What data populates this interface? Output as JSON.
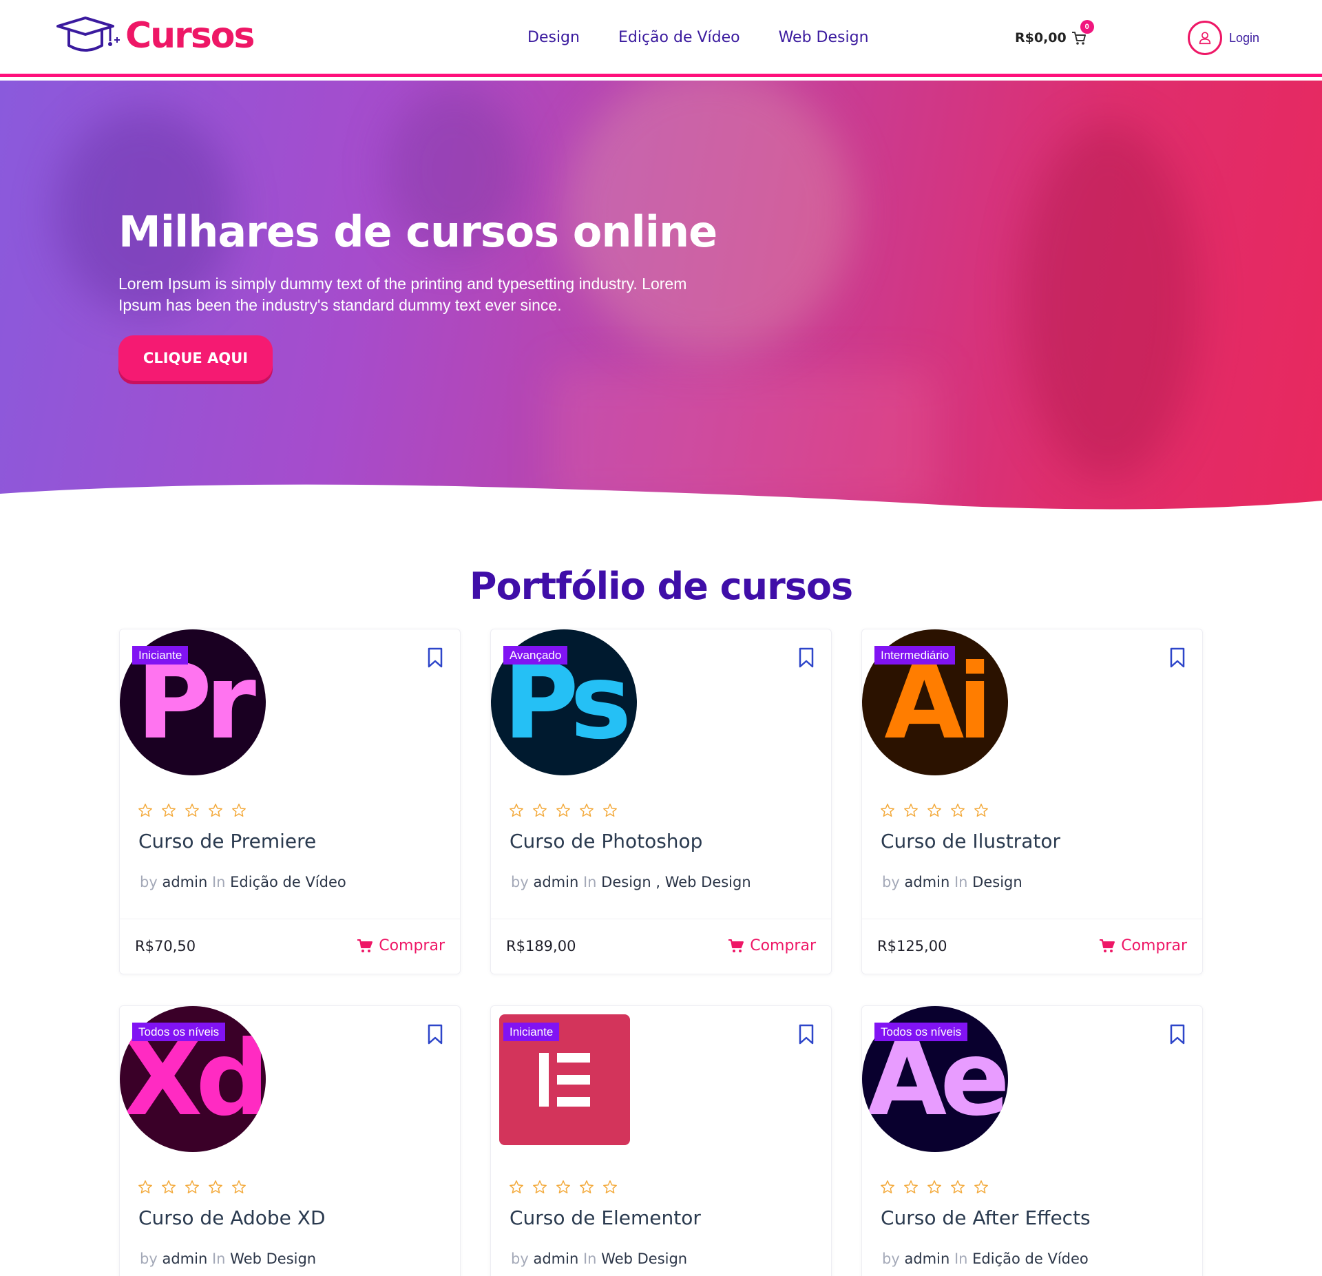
{
  "header": {
    "logo_text": "Cursos",
    "nav": [
      "Design",
      "Edição de Vídeo",
      "Web Design"
    ],
    "cart_total": "R$0,00",
    "cart_count": "0",
    "login_label": "Login"
  },
  "hero": {
    "title": "Milhares de cursos online",
    "description": "Lorem Ipsum is simply dummy text of the printing and typesetting industry. Lorem Ipsum has been the industry's standard dummy text ever since.",
    "button_label": "CLIQUE AQUI"
  },
  "section": {
    "title": "Portfólio de cursos"
  },
  "labels": {
    "by": "by",
    "author": "admin",
    "in": "In",
    "buy": "Comprar"
  },
  "courses": [
    {
      "level": "Iniciante",
      "title": "Curso de Premiere",
      "categories": "Edição de Vídeo",
      "price": "R$70,50",
      "icon": "premiere-pro-icon",
      "icon_text": "Pr",
      "rating": 0
    },
    {
      "level": "Avançado",
      "title": "Curso de Photoshop",
      "categories": "Design ,  Web Design",
      "price": "R$189,00",
      "icon": "photoshop-icon",
      "icon_text": "Ps",
      "rating": 0
    },
    {
      "level": "Intermediário",
      "title": "Curso de Ilustrator",
      "categories": "Design",
      "price": "R$125,00",
      "icon": "illustrator-icon",
      "icon_text": "Ai",
      "rating": 0
    },
    {
      "level": "Todos os níveis",
      "title": "Curso de Adobe XD",
      "categories": "Web Design",
      "icon": "adobe-xd-icon",
      "icon_text": "Xd",
      "rating": 0
    },
    {
      "level": "Iniciante",
      "title": "Curso de Elementor",
      "categories": "Web Design",
      "icon": "elementor-icon",
      "rating": 0
    },
    {
      "level": "Todos os níveis",
      "title": "Curso de After Effects",
      "categories": "Edição de Vídeo",
      "icon": "after-effects-icon",
      "icon_text": "Ae",
      "rating": 0
    }
  ],
  "colors": {
    "accent": "#ee1766",
    "brand_purple": "#3f0ea8",
    "badge_purple": "#8113f3",
    "star": "#f3a93a",
    "premiere_bg": "#1a0022",
    "premiere_fg": "#ff74f0",
    "photoshop_bg": "#001a2f",
    "photoshop_fg": "#25c0f5",
    "illustrator_bg": "#2b1200",
    "illustrator_fg": "#ff7d00",
    "xd_bg": "#3a0028",
    "xd_fg": "#ff2bc2",
    "elementor_bg": "#d3345b",
    "ae_bg": "#09002e",
    "ae_fg": "#e89cff"
  }
}
